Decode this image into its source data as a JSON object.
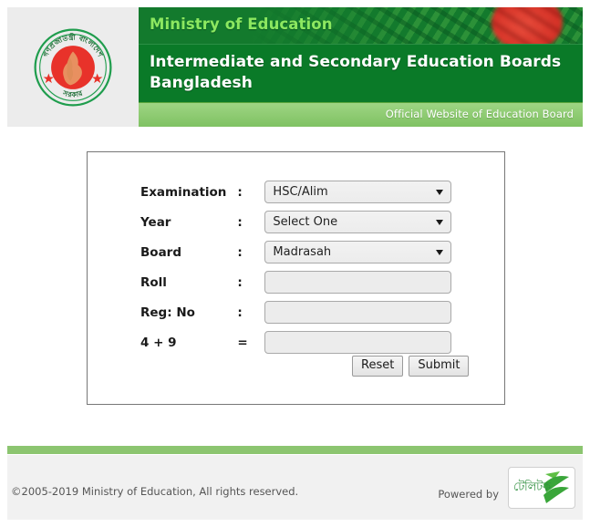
{
  "header": {
    "emblem_name": "bangladesh-government-emblem",
    "ministry_label": "Ministry of Education",
    "board_title": "Intermediate and Secondary Education Boards Bangladesh",
    "official_label": "Official Website of Education Board"
  },
  "form": {
    "rows": [
      {
        "label": "Examination",
        "separator": ":",
        "type": "select",
        "value": "HSC/Alim"
      },
      {
        "label": "Year",
        "separator": ":",
        "type": "select",
        "value": "Select One"
      },
      {
        "label": "Board",
        "separator": ":",
        "type": "select",
        "value": "Madrasah"
      },
      {
        "label": "Roll",
        "separator": ":",
        "type": "text",
        "value": ""
      },
      {
        "label": "Reg: No",
        "separator": ":",
        "type": "text",
        "value": ""
      },
      {
        "label": "4 + 9",
        "separator": "=",
        "type": "text",
        "value": ""
      }
    ],
    "reset_label": "Reset",
    "submit_label": "Submit"
  },
  "footer": {
    "copyright": "©2005-2019 Ministry of Education, All rights reserved.",
    "powered_by": "Powered by",
    "teletalk_label": "টেলিটক"
  },
  "colors": {
    "header_green_top": "#137a2d",
    "header_green_mid": "#0a7a28",
    "header_green_light": "#8ecb72",
    "ministry_text": "#8ce860",
    "footer_bar": "#8cc570",
    "flag_red": "#e0332a",
    "teletalk_green": "#2f8f3f"
  }
}
